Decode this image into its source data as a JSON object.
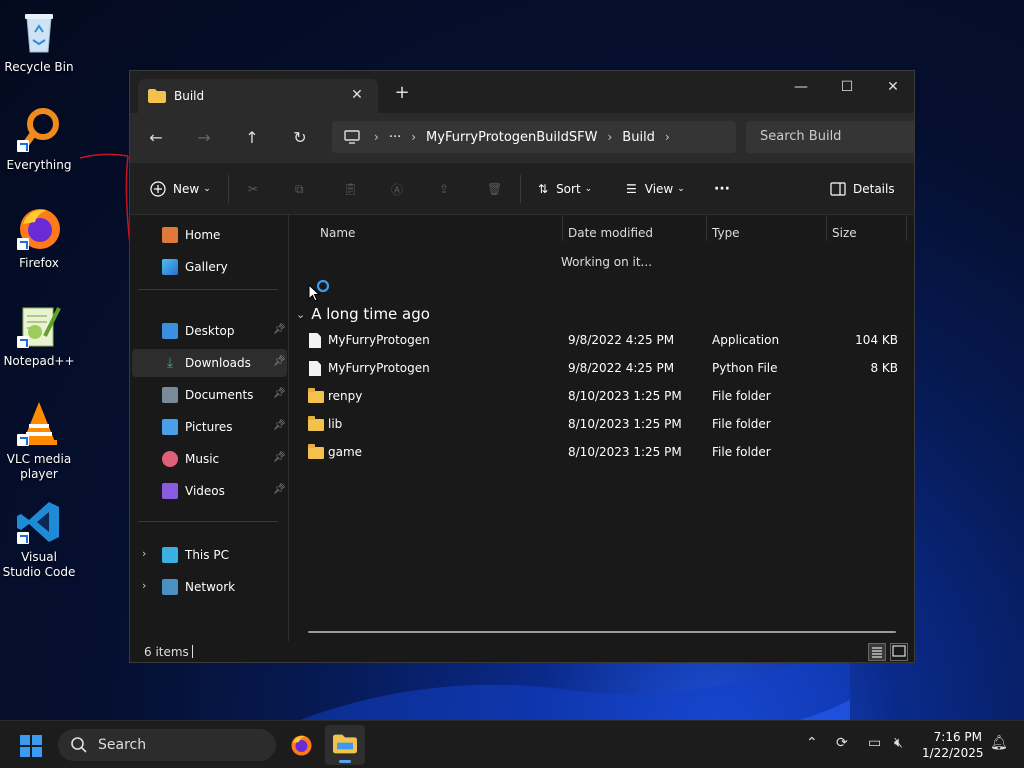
{
  "desktop": {
    "icons": [
      {
        "label": "Recycle Bin",
        "icon": "recycle-bin-icon"
      },
      {
        "label": "Everything",
        "icon": "everything-search-icon"
      },
      {
        "label": "Firefox",
        "icon": "firefox-icon"
      },
      {
        "label": "Notepad++",
        "icon": "notepad-plus-plus-icon"
      },
      {
        "label": "VLC media player",
        "icon": "vlc-icon"
      },
      {
        "label": "Visual Studio Code",
        "icon": "vscode-icon"
      }
    ]
  },
  "window": {
    "tab_title": "Build",
    "address": {
      "segments": [
        "MyFurryProtogenBuildSFW",
        "Build"
      ],
      "ellipsis": "···"
    },
    "search_placeholder": "Search Build",
    "toolbar": {
      "new_label": "New",
      "sort_label": "Sort",
      "view_label": "View",
      "more_label": "···",
      "details_label": "Details"
    },
    "sidebar": {
      "top": [
        {
          "label": "Home",
          "icon": "home-icon"
        },
        {
          "label": "Gallery",
          "icon": "gallery-icon"
        }
      ],
      "quick": [
        {
          "label": "Desktop",
          "icon": "desktop-icon"
        },
        {
          "label": "Downloads",
          "icon": "download-icon"
        },
        {
          "label": "Documents",
          "icon": "documents-icon"
        },
        {
          "label": "Pictures",
          "icon": "pictures-icon"
        },
        {
          "label": "Music",
          "icon": "music-icon"
        },
        {
          "label": "Videos",
          "icon": "videos-icon"
        }
      ],
      "bottom": [
        {
          "label": "This PC",
          "icon": "pc-icon"
        },
        {
          "label": "Network",
          "icon": "network-icon"
        }
      ]
    },
    "columns": [
      "Name",
      "Date modified",
      "Type",
      "Size"
    ],
    "working_text": "Working on it...",
    "group_label": "A long time ago",
    "files": [
      {
        "name": "MyFurryProtogen",
        "date": "9/8/2022 4:25 PM",
        "type": "Application",
        "size": "104 KB",
        "kind": "file"
      },
      {
        "name": "MyFurryProtogen",
        "date": "9/8/2022 4:25 PM",
        "type": "Python File",
        "size": "8 KB",
        "kind": "file"
      },
      {
        "name": "renpy",
        "date": "8/10/2023 1:25 PM",
        "type": "File folder",
        "size": "",
        "kind": "folder"
      },
      {
        "name": "lib",
        "date": "8/10/2023 1:25 PM",
        "type": "File folder",
        "size": "",
        "kind": "folder"
      },
      {
        "name": "game",
        "date": "8/10/2023 1:25 PM",
        "type": "File folder",
        "size": "",
        "kind": "folder"
      }
    ],
    "status_count": "6 items"
  },
  "taskbar": {
    "search_label": "Search",
    "time": "7:16 PM",
    "date": "1/22/2025"
  },
  "colors": {
    "accent": "#3a9bf0",
    "folder": "#f2c14e",
    "window_bg": "#191919"
  }
}
